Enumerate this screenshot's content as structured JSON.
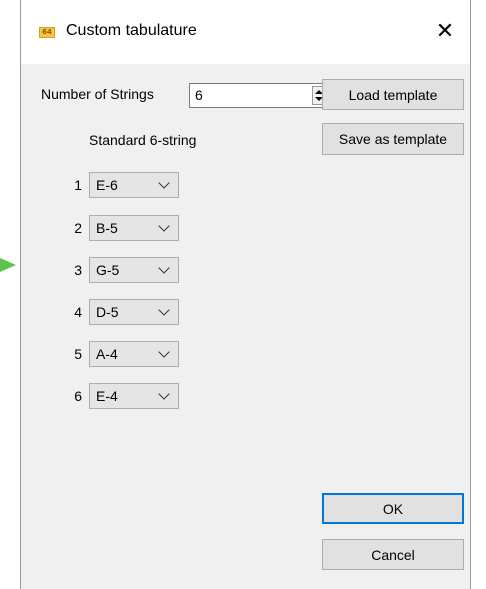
{
  "window": {
    "title": "Custom tabulature",
    "icon": "app-icon",
    "close_symbol": "✕"
  },
  "strings_count": {
    "label": "Number of Strings",
    "value": "6"
  },
  "preset_label": "Standard 6-string",
  "buttons": {
    "load_template": "Load template",
    "save_template": "Save as template",
    "ok": "OK",
    "cancel": "Cancel"
  },
  "strings": [
    {
      "num": "1",
      "note": "E-6"
    },
    {
      "num": "2",
      "note": "B-5"
    },
    {
      "num": "3",
      "note": "G-5"
    },
    {
      "num": "4",
      "note": "D-5"
    },
    {
      "num": "5",
      "note": "A-4"
    },
    {
      "num": "6",
      "note": "E-4"
    }
  ],
  "colors": {
    "accent": "#0078d7",
    "arrow": "#5cc44a",
    "dialog_bg": "#f0f0f0"
  }
}
